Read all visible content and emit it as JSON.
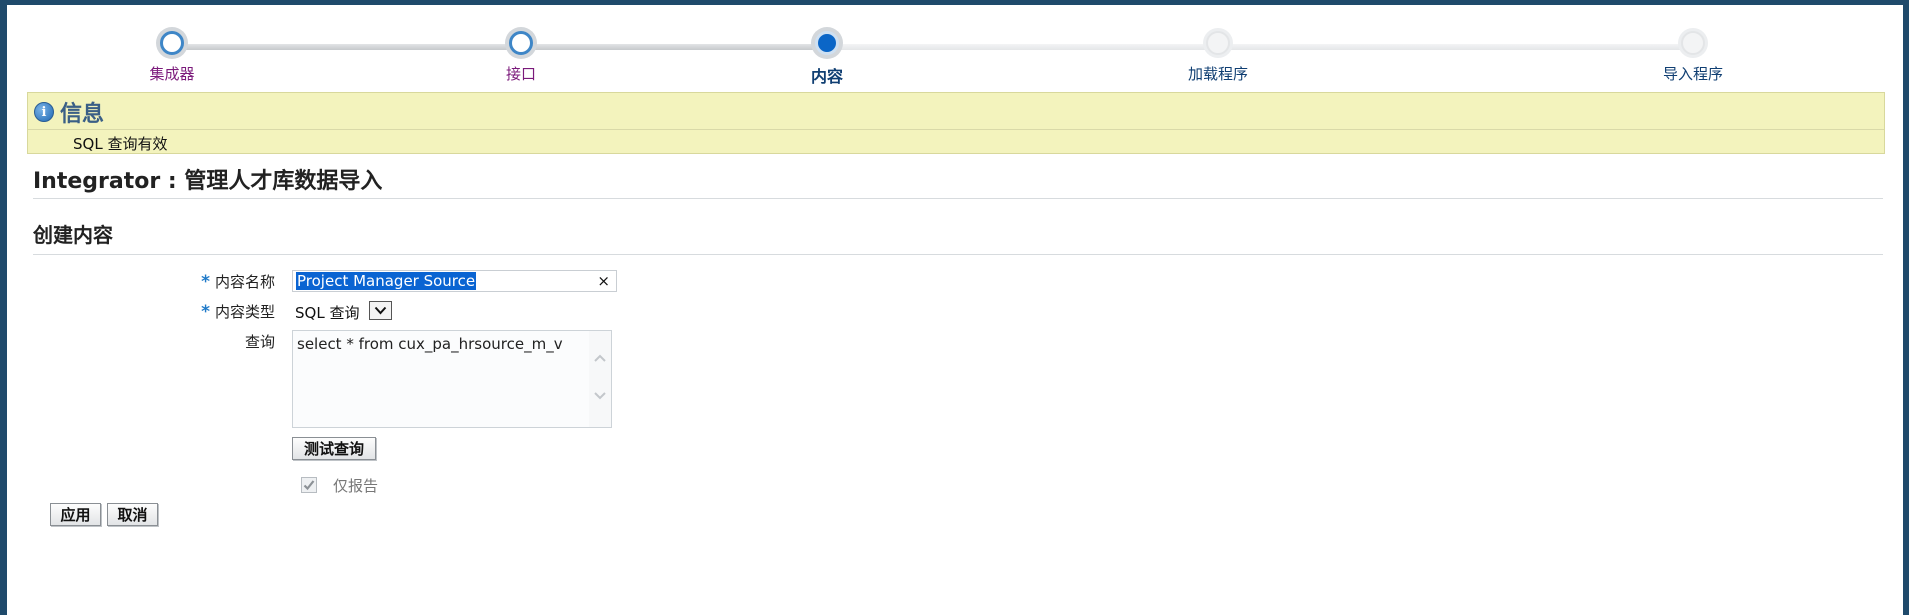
{
  "train": {
    "steps": [
      {
        "label": "集成器",
        "state": "visited"
      },
      {
        "label": "接口",
        "state": "visited"
      },
      {
        "label": "内容",
        "state": "current"
      },
      {
        "label": "加载程序",
        "state": "pending"
      },
      {
        "label": "导入程序",
        "state": "pending"
      }
    ]
  },
  "info": {
    "icon": "info-icon",
    "icon_glyph": "i",
    "title": "信息",
    "message": "SQL 查询有效"
  },
  "page": {
    "title": "Integrator : 管理人才库数据导入",
    "section_title": "创建内容"
  },
  "form": {
    "required_mark": "*",
    "content_name_label": "内容名称",
    "content_name_value": "Project Manager Source",
    "clear_glyph": "×",
    "content_type_label": "内容类型",
    "content_type_value": "SQL 查询",
    "query_label": "查询",
    "query_value": "select * from cux_pa_hrsource_m_v",
    "test_query_button": "测试查询",
    "report_only_label": "仅报告",
    "report_only_checked": true
  },
  "actions": {
    "apply": "应用",
    "cancel": "取消"
  },
  "colors": {
    "accent": "#0b66c7",
    "info_background": "#f3f3bd",
    "frame_border": "#1f4a6b",
    "visited_label": "#7b1a7b"
  }
}
